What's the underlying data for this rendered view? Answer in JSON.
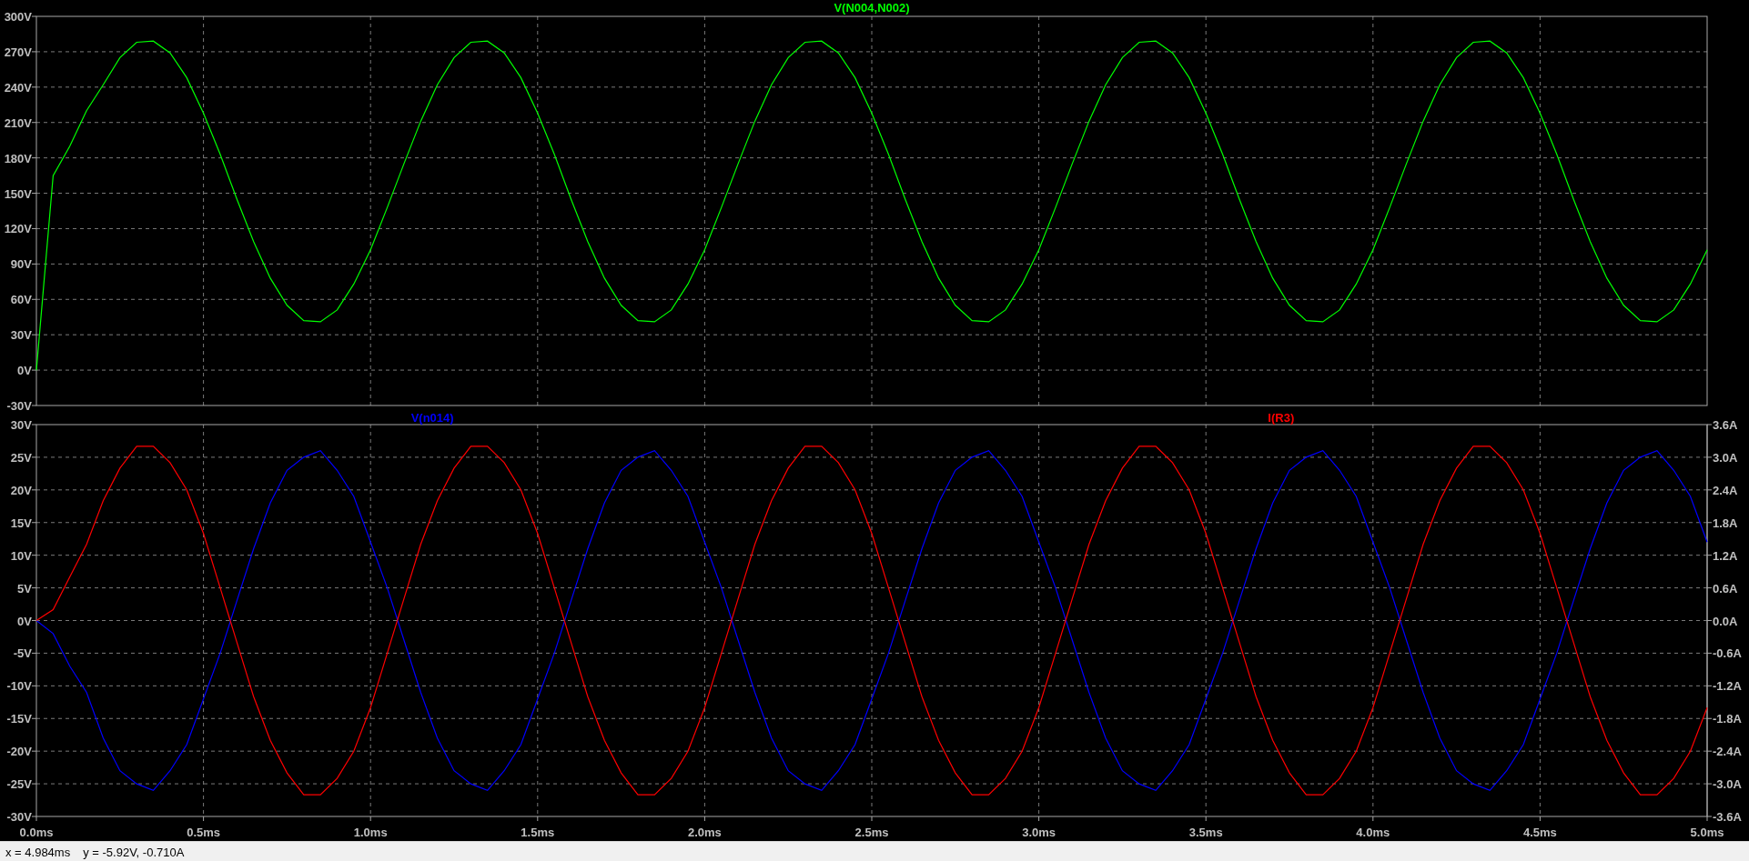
{
  "panels": [
    {
      "chart_data": {
        "type": "line",
        "grid": true,
        "xlim": [
          0,
          5
        ],
        "ylim": [
          -30,
          300
        ],
        "yticks": [
          {
            "value": 300,
            "label": "300V"
          },
          {
            "value": 270,
            "label": "270V"
          },
          {
            "value": 240,
            "label": "240V"
          },
          {
            "value": 210,
            "label": "210V"
          },
          {
            "value": 180,
            "label": "180V"
          },
          {
            "value": 150,
            "label": "150V"
          },
          {
            "value": 120,
            "label": "120V"
          },
          {
            "value": 90,
            "label": "90V"
          },
          {
            "value": 60,
            "label": "60V"
          },
          {
            "value": 30,
            "label": "30V"
          },
          {
            "value": 0,
            "label": "0V"
          },
          {
            "value": -30,
            "label": "-30V"
          }
        ],
        "x": [
          0,
          0.05,
          0.1,
          0.15,
          0.2,
          0.25,
          0.3,
          0.35,
          0.4,
          0.45,
          0.5,
          0.55,
          0.6,
          0.65,
          0.7,
          0.75,
          0.8,
          0.85,
          0.9,
          0.95,
          1,
          1.05,
          1.1,
          1.15,
          1.2,
          1.25,
          1.3,
          1.35,
          1.4,
          1.45,
          1.5,
          1.55,
          1.6,
          1.65,
          1.7,
          1.75,
          1.8,
          1.85,
          1.9,
          1.95,
          2,
          2.05,
          2.1,
          2.15,
          2.2,
          2.25,
          2.3,
          2.35,
          2.4,
          2.45,
          2.5,
          2.55,
          2.6,
          2.65,
          2.7,
          2.75,
          2.8,
          2.85,
          2.9,
          2.95,
          3,
          3.05,
          3.1,
          3.15,
          3.2,
          3.25,
          3.3,
          3.35,
          3.4,
          3.45,
          3.5,
          3.55,
          3.6,
          3.65,
          3.7,
          3.75,
          3.8,
          3.85,
          3.9,
          3.95,
          4,
          4.05,
          4.1,
          4.15,
          4.2,
          4.25,
          4.3,
          4.35,
          4.4,
          4.45,
          4.5,
          4.55,
          4.6,
          4.65,
          4.7,
          4.75,
          4.8,
          4.85,
          4.9,
          4.95,
          5
        ],
        "series": [
          {
            "name": "V(N004,N002)",
            "color": "#00ff00",
            "axis": "y",
            "values": [
              0,
              165,
              190,
              220,
              242,
              265,
              278,
              279,
              269,
              248,
              218,
              183,
              145,
              109,
              78,
              55,
              42,
              41,
              51,
              73,
              102,
              138,
              175,
              211,
              242,
              265,
              278,
              279,
              269,
              248,
              218,
              183,
              145,
              109,
              78,
              55,
              42,
              41,
              51,
              73,
              102,
              138,
              175,
              211,
              242,
              265,
              278,
              279,
              269,
              248,
              218,
              183,
              145,
              109,
              78,
              55,
              42,
              41,
              51,
              73,
              102,
              138,
              175,
              211,
              242,
              265,
              278,
              279,
              269,
              248,
              218,
              183,
              145,
              109,
              78,
              55,
              42,
              41,
              51,
              73,
              102,
              138,
              175,
              211,
              242,
              265,
              278,
              279,
              269,
              248,
              218,
              183,
              145,
              109,
              78,
              55,
              42,
              41,
              51,
              73,
              102
            ]
          }
        ]
      }
    },
    {
      "chart_data": {
        "type": "line",
        "grid": true,
        "xlim": [
          0,
          5
        ],
        "ylim": [
          -30,
          30
        ],
        "y2lim": [
          -3.6,
          3.6
        ],
        "xticks": [
          {
            "value": 0,
            "label": "0.0ms"
          },
          {
            "value": 0.5,
            "label": "0.5ms"
          },
          {
            "value": 1,
            "label": "1.0ms"
          },
          {
            "value": 1.5,
            "label": "1.5ms"
          },
          {
            "value": 2,
            "label": "2.0ms"
          },
          {
            "value": 2.5,
            "label": "2.5ms"
          },
          {
            "value": 3,
            "label": "3.0ms"
          },
          {
            "value": 3.5,
            "label": "3.5ms"
          },
          {
            "value": 4,
            "label": "4.0ms"
          },
          {
            "value": 4.5,
            "label": "4.5ms"
          },
          {
            "value": 5,
            "label": "5.0ms"
          }
        ],
        "yticks": [
          {
            "value": 30,
            "label": "30V"
          },
          {
            "value": 25,
            "label": "25V"
          },
          {
            "value": 20,
            "label": "20V"
          },
          {
            "value": 15,
            "label": "15V"
          },
          {
            "value": 10,
            "label": "10V"
          },
          {
            "value": 5,
            "label": "5V"
          },
          {
            "value": 0,
            "label": "0V"
          },
          {
            "value": -5,
            "label": "-5V"
          },
          {
            "value": -10,
            "label": "-10V"
          },
          {
            "value": -15,
            "label": "-15V"
          },
          {
            "value": -20,
            "label": "-20V"
          },
          {
            "value": -25,
            "label": "-25V"
          },
          {
            "value": -30,
            "label": "-30V"
          }
        ],
        "y2ticks": [
          {
            "value": 3.6,
            "label": "3.6A"
          },
          {
            "value": 3,
            "label": "3.0A"
          },
          {
            "value": 2.4,
            "label": "2.4A"
          },
          {
            "value": 1.8,
            "label": "1.8A"
          },
          {
            "value": 1.2,
            "label": "1.2A"
          },
          {
            "value": 0.6,
            "label": "0.6A"
          },
          {
            "value": 0,
            "label": "0.0A"
          },
          {
            "value": -0.6,
            "label": "-0.6A"
          },
          {
            "value": -1.2,
            "label": "-1.2A"
          },
          {
            "value": -1.8,
            "label": "-1.8A"
          },
          {
            "value": -2.4,
            "label": "-2.4A"
          },
          {
            "value": -3,
            "label": "-3.0A"
          },
          {
            "value": -3.6,
            "label": "-3.6A"
          }
        ],
        "x": [
          0,
          0.05,
          0.1,
          0.15,
          0.2,
          0.25,
          0.3,
          0.35,
          0.4,
          0.45,
          0.5,
          0.55,
          0.6,
          0.65,
          0.7,
          0.75,
          0.8,
          0.85,
          0.9,
          0.95,
          1,
          1.05,
          1.1,
          1.15,
          1.2,
          1.25,
          1.3,
          1.35,
          1.4,
          1.45,
          1.5,
          1.55,
          1.6,
          1.65,
          1.7,
          1.75,
          1.8,
          1.85,
          1.9,
          1.95,
          2,
          2.05,
          2.1,
          2.15,
          2.2,
          2.25,
          2.3,
          2.35,
          2.4,
          2.45,
          2.5,
          2.55,
          2.6,
          2.65,
          2.7,
          2.75,
          2.8,
          2.85,
          2.9,
          2.95,
          3,
          3.05,
          3.1,
          3.15,
          3.2,
          3.25,
          3.3,
          3.35,
          3.4,
          3.45,
          3.5,
          3.55,
          3.6,
          3.65,
          3.7,
          3.75,
          3.8,
          3.85,
          3.9,
          3.95,
          4,
          4.05,
          4.1,
          4.15,
          4.2,
          4.25,
          4.3,
          4.35,
          4.4,
          4.45,
          4.5,
          4.55,
          4.6,
          4.65,
          4.7,
          4.75,
          4.8,
          4.85,
          4.9,
          4.95,
          5
        ],
        "series": [
          {
            "name": "V(n014)",
            "color": "#0000ff",
            "axis": "y",
            "values": [
              0,
              -2,
              -7,
              -11,
              -18,
              -23,
              -25,
              -26,
              -23,
              -19,
              -12,
              -5,
              3,
              11,
              18,
              23,
              25,
              26,
              23,
              19,
              12,
              5,
              -3,
              -11,
              -18,
              -23,
              -25,
              -26,
              -23,
              -19,
              -12,
              -5,
              3,
              11,
              18,
              23,
              25,
              26,
              23,
              19,
              12,
              5,
              -3,
              -11,
              -18,
              -23,
              -25,
              -26,
              -23,
              -19,
              -12,
              -5,
              3,
              11,
              18,
              23,
              25,
              26,
              23,
              19,
              12,
              5,
              -3,
              -11,
              -18,
              -23,
              -25,
              -26,
              -23,
              -19,
              -12,
              -5,
              3,
              11,
              18,
              23,
              25,
              26,
              23,
              19,
              12,
              5,
              -3,
              -11,
              -18,
              -23,
              -25,
              -26,
              -23,
              -19,
              -12,
              -5,
              3,
              11,
              18,
              23,
              25,
              26,
              23,
              19,
              12
            ]
          },
          {
            "name": "I(R3)",
            "color": "#ff0000",
            "axis": "y2",
            "values": [
              0,
              0.2,
              0.8,
              1.4,
              2.2,
              2.8,
              3.2,
              3.2,
              2.9,
              2.4,
              1.6,
              0.6,
              -0.4,
              -1.4,
              -2.2,
              -2.8,
              -3.2,
              -3.2,
              -2.9,
              -2.4,
              -1.6,
              -0.6,
              0.4,
              1.4,
              2.2,
              2.8,
              3.2,
              3.2,
              2.9,
              2.4,
              1.6,
              0.6,
              -0.4,
              -1.4,
              -2.2,
              -2.8,
              -3.2,
              -3.2,
              -2.9,
              -2.4,
              -1.6,
              -0.6,
              0.4,
              1.4,
              2.2,
              2.8,
              3.2,
              3.2,
              2.9,
              2.4,
              1.6,
              0.6,
              -0.4,
              -1.4,
              -2.2,
              -2.8,
              -3.2,
              -3.2,
              -2.9,
              -2.4,
              -1.6,
              -0.6,
              0.4,
              1.4,
              2.2,
              2.8,
              3.2,
              3.2,
              2.9,
              2.4,
              1.6,
              0.6,
              -0.4,
              -1.4,
              -2.2,
              -2.8,
              -3.2,
              -3.2,
              -2.9,
              -2.4,
              -1.6,
              -0.6,
              0.4,
              1.4,
              2.2,
              2.8,
              3.2,
              3.2,
              2.9,
              2.4,
              1.6,
              0.6,
              -0.4,
              -1.4,
              -2.2,
              -2.8,
              -3.2,
              -3.2,
              -2.9,
              -2.4,
              -1.6
            ]
          }
        ]
      }
    }
  ],
  "status_bar": {
    "x_readout": "x = 4.984ms",
    "y_readout": "y = -5.92V, -0.710A"
  }
}
